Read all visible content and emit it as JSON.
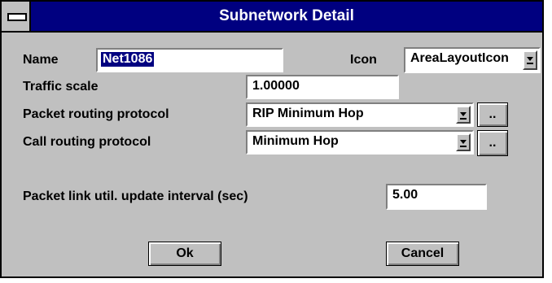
{
  "window": {
    "title": "Subnetwork Detail"
  },
  "name": {
    "label": "Name",
    "value": "Net1086"
  },
  "icon": {
    "label": "Icon",
    "value": "AreaLayoutIcon"
  },
  "traffic_scale": {
    "label": "Traffic scale",
    "value": "1.00000"
  },
  "packet_routing": {
    "label": "Packet routing protocol",
    "value": "RIP Minimum Hop",
    "browse_label": ".."
  },
  "call_routing": {
    "label": "Call routing protocol",
    "value": "Minimum Hop",
    "browse_label": ".."
  },
  "packet_link": {
    "label": "Packet link util. update interval (sec)",
    "value": "5.00"
  },
  "buttons": {
    "ok": "Ok",
    "cancel": "Cancel"
  },
  "icons": [
    "system-menu-icon",
    "dropdown-arrow-icon"
  ]
}
